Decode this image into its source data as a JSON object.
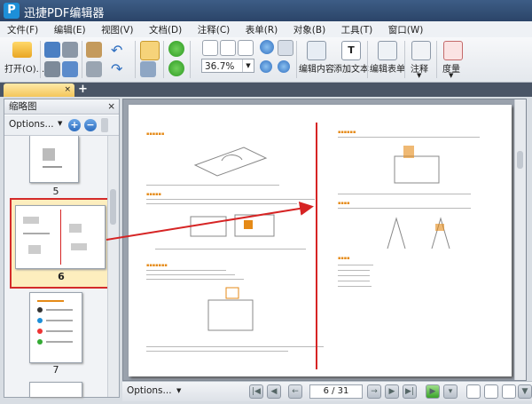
{
  "app": {
    "title": "迅捷PDF编辑器",
    "logo_letter": "P"
  },
  "menu": [
    "文件(F)",
    "编辑(E)",
    "视图(V)",
    "文档(D)",
    "注释(C)",
    "表单(R)",
    "对象(B)",
    "工具(T)",
    "窗口(W)"
  ],
  "toolbar": {
    "open_label": "打开(O)...",
    "zoom_value": "36.7%",
    "edit_content": "编辑内容",
    "add_text": "添加文本",
    "edit_form": "编辑表单",
    "annotate": "注释",
    "measure": "度量"
  },
  "tab": {
    "label": ""
  },
  "sidebar": {
    "title": "缩略图",
    "options": "Options...",
    "pages": [
      "5",
      "6",
      "7"
    ]
  },
  "bottom": {
    "options": "Options...",
    "page_indicator": "6 / 31"
  }
}
